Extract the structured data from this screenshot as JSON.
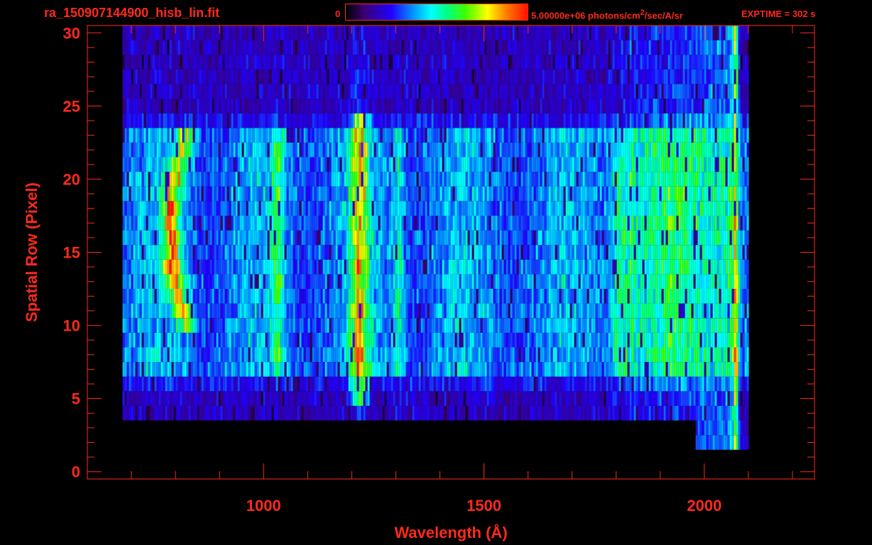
{
  "header": {
    "title": "ra_150907144900_hisb_lin.fit",
    "colorbar_min": "0",
    "colorbar_max": "5.00000e+06",
    "colorbar_units_prefix": "photons/cm",
    "colorbar_units_exp": "2",
    "colorbar_units_suffix": "/sec/A/sr",
    "exptime": "EXPTIME = 302 s"
  },
  "colors": {
    "axis": "#ff2a1a",
    "background": "#000000"
  },
  "chart_data": {
    "type": "heatmap",
    "xlabel": "Wavelength (Å)",
    "ylabel": "Spatial Row (Pixel)",
    "xlim": [
      600,
      2250
    ],
    "ylim": [
      -0.5,
      30.5
    ],
    "x_ticks": [
      1000,
      1500,
      2000
    ],
    "y_ticks": [
      0,
      5,
      10,
      15,
      20,
      25,
      30
    ],
    "colorbar_range": [
      0,
      5000000
    ],
    "rows": 31,
    "features": [
      {
        "name": "arc",
        "x": [
          780,
          860
        ],
        "y": [
          10,
          23
        ]
      },
      {
        "name": "line",
        "x": [
          1200,
          1240
        ],
        "y": [
          5,
          24
        ]
      },
      {
        "name": "band",
        "x": [
          1780,
          1830
        ],
        "y": [
          6,
          23
        ]
      },
      {
        "name": "edge",
        "x": [
          2060,
          2075
        ],
        "y": [
          2,
          30
        ]
      }
    ]
  }
}
